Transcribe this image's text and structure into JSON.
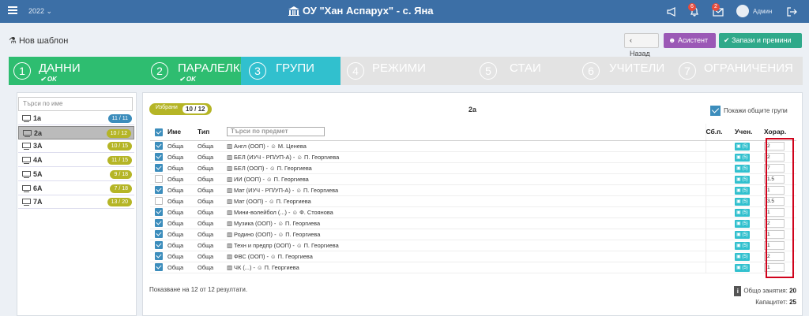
{
  "topbar": {
    "year": "2022 ⌄",
    "school": "ОУ \"Хан Аспарух\" - с. Яна",
    "bell_count": "6",
    "msg_count": "2",
    "user": "Админ"
  },
  "page": {
    "title": "Нов шаблон",
    "back": "Назад",
    "assistant": "Асистент",
    "save": "Запази и премини"
  },
  "wizard": [
    {
      "n": "1",
      "label": "ДАННИ",
      "ok": "✔ OK"
    },
    {
      "n": "2",
      "label": "ПАРАЛЕЛКИ",
      "ok": "✔ OK"
    },
    {
      "n": "3",
      "label": "ГРУПИ"
    },
    {
      "n": "4",
      "label": "РЕЖИМИ"
    },
    {
      "n": "5",
      "label": "СТАИ"
    },
    {
      "n": "6",
      "label": "УЧИТЕЛИ"
    },
    {
      "n": "7",
      "label": "ОГРАНИЧЕНИЯ"
    }
  ],
  "sidebar": {
    "search_placeholder": "Търси по име",
    "classes": [
      {
        "name": "1а",
        "count": "11 / 11",
        "color": "#3c8dbc"
      },
      {
        "name": "2а",
        "count": "10 / 12",
        "color": "#b5b526"
      },
      {
        "name": "3А",
        "count": "10 / 15",
        "color": "#b5b526"
      },
      {
        "name": "4А",
        "count": "11 / 15",
        "color": "#b5b526"
      },
      {
        "name": "5А",
        "count": "9 / 18",
        "color": "#b5b526"
      },
      {
        "name": "6А",
        "count": "7 / 18",
        "color": "#b5b526"
      },
      {
        "name": "7А",
        "count": "13 / 20",
        "color": "#b5b526"
      }
    ]
  },
  "main": {
    "selected_label": "Избрани",
    "selected_count": "10 / 12",
    "class_title": "2а",
    "show_common": "Покажи общите групи",
    "headers": {
      "name": "Име",
      "type": "Тип",
      "search_placeholder": "Търси по предмет",
      "sb": "Сб.п.",
      "students": "Учен.",
      "hours": "Хорар."
    },
    "students_btn": "(5)",
    "rows": [
      {
        "checked": true,
        "name": "Обща",
        "type": "Обща",
        "subject": "Англ (ООП) - ",
        "teacher": "М. Ценева",
        "hours": "2"
      },
      {
        "checked": true,
        "name": "Обща",
        "type": "Обща",
        "subject": "БЕЛ (ИУЧ - РП/УП-А) - ",
        "teacher": "П. Георгиева",
        "hours": "2"
      },
      {
        "checked": true,
        "name": "Обща",
        "type": "Обща",
        "subject": "БЕЛ (ООП) - ",
        "teacher": "П. Георгиева",
        "hours": "7"
      },
      {
        "checked": false,
        "name": "Обща",
        "type": "Обща",
        "subject": "ИИ (ООП) - ",
        "teacher": "П. Георгиева",
        "hours": "1.5"
      },
      {
        "checked": true,
        "name": "Обща",
        "type": "Обща",
        "subject": "Мат (ИУЧ - РП/УП-А) - ",
        "teacher": "П. Георгиева",
        "hours": "1"
      },
      {
        "checked": false,
        "name": "Обща",
        "type": "Обща",
        "subject": "Мат (ООП) - ",
        "teacher": "П. Георгиева",
        "hours": "3.5"
      },
      {
        "checked": true,
        "name": "Обща",
        "type": "Обща",
        "subject": "Мини-волейбол (...) - ",
        "teacher": "Ф. Стоянова",
        "hours": "1"
      },
      {
        "checked": true,
        "name": "Обща",
        "type": "Обща",
        "subject": "Музика (ООП) - ",
        "teacher": "П. Георгиева",
        "hours": "2"
      },
      {
        "checked": true,
        "name": "Обща",
        "type": "Обща",
        "subject": "Родино (ООП) - ",
        "teacher": "П. Георгиева",
        "hours": "1"
      },
      {
        "checked": true,
        "name": "Обща",
        "type": "Обща",
        "subject": "Техн и предпр (ООП) - ",
        "teacher": "П. Георгиева",
        "hours": "1"
      },
      {
        "checked": true,
        "name": "Обща",
        "type": "Обща",
        "subject": "ФВС (ООП) - ",
        "teacher": "П. Георгиева",
        "hours": "2"
      },
      {
        "checked": true,
        "name": "Обща",
        "type": "Обща",
        "subject": "ЧК (...) - ",
        "teacher": "П. Георгиева",
        "hours": "1"
      }
    ],
    "pager": "Показване на 12 от 12 резултати.",
    "total_label": "Общо занятия:",
    "total_value": "20",
    "capacity_label": "Капацитет:",
    "capacity_value": "25"
  }
}
